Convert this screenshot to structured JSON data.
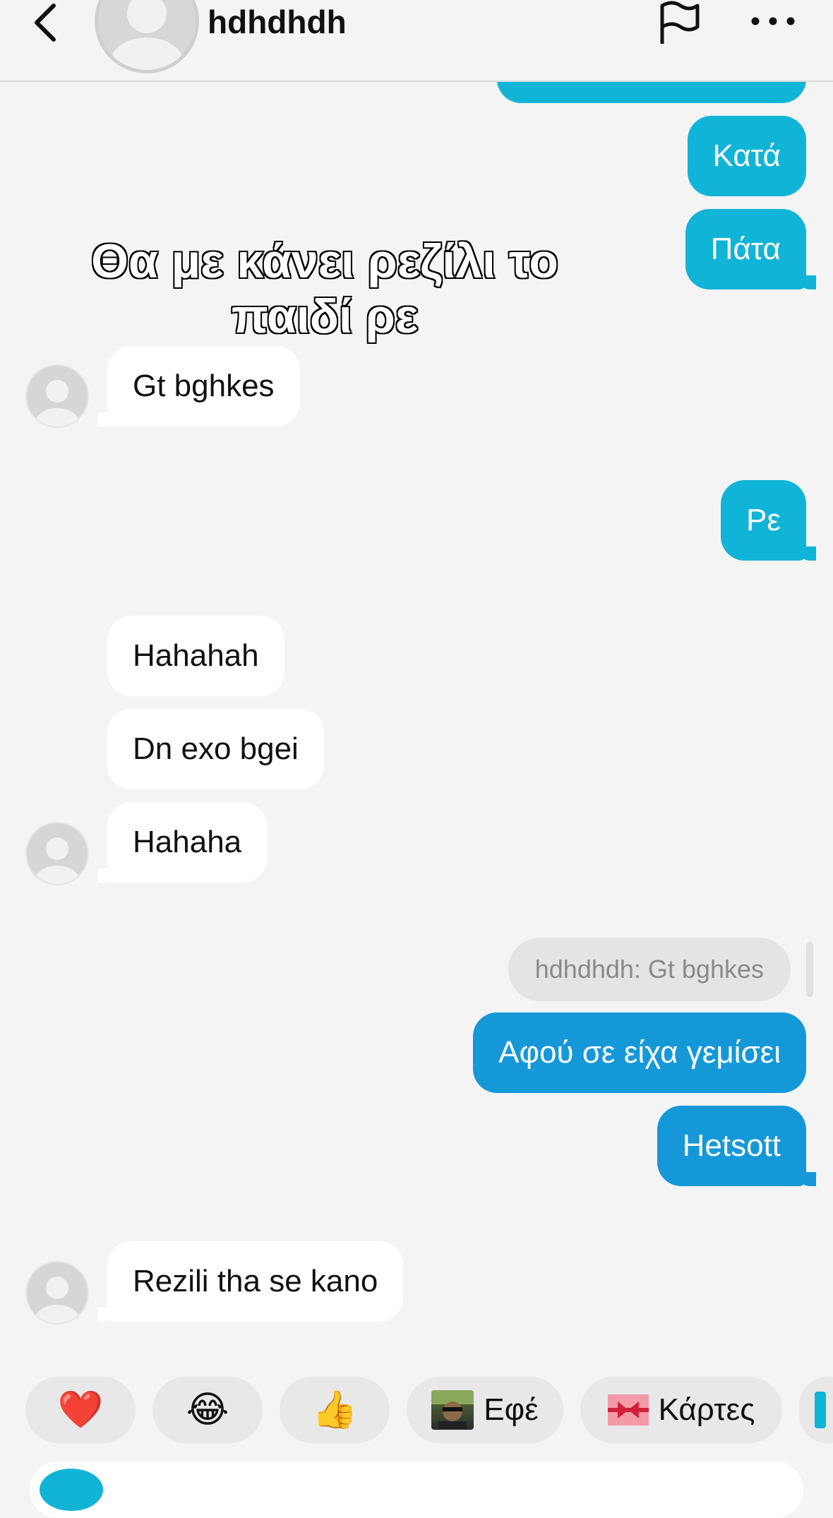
{
  "header": {
    "username": "hdhdhdh"
  },
  "caption": {
    "line1": "Θα με κάνει ρεζίλι το",
    "line2": "παιδί ρε"
  },
  "messages": {
    "m1": "Κατά",
    "m2": "Πάτα",
    "m3": "Gt bghkes",
    "m4": "Ρε",
    "m5": "Hahahah",
    "m6": "Dn exo bgei",
    "m7": "Hahaha",
    "reply_quote": "hdhdhdh: Gt bghkes",
    "m8": "Αφού σε είχα γεμίσει",
    "m9": "Hetsott",
    "m10": "Rezili tha se kano"
  },
  "quick_reactions": {
    "heart": "❤️",
    "laugh": "😂",
    "thumbs": "👍",
    "effects_label": "Εφέ",
    "cards_label": "Κάρτες"
  },
  "colors": {
    "outgoing_teal": "#10b4d6",
    "outgoing_blue": "#1598d8",
    "incoming": "#ffffff",
    "background": "#f4f4f4"
  }
}
